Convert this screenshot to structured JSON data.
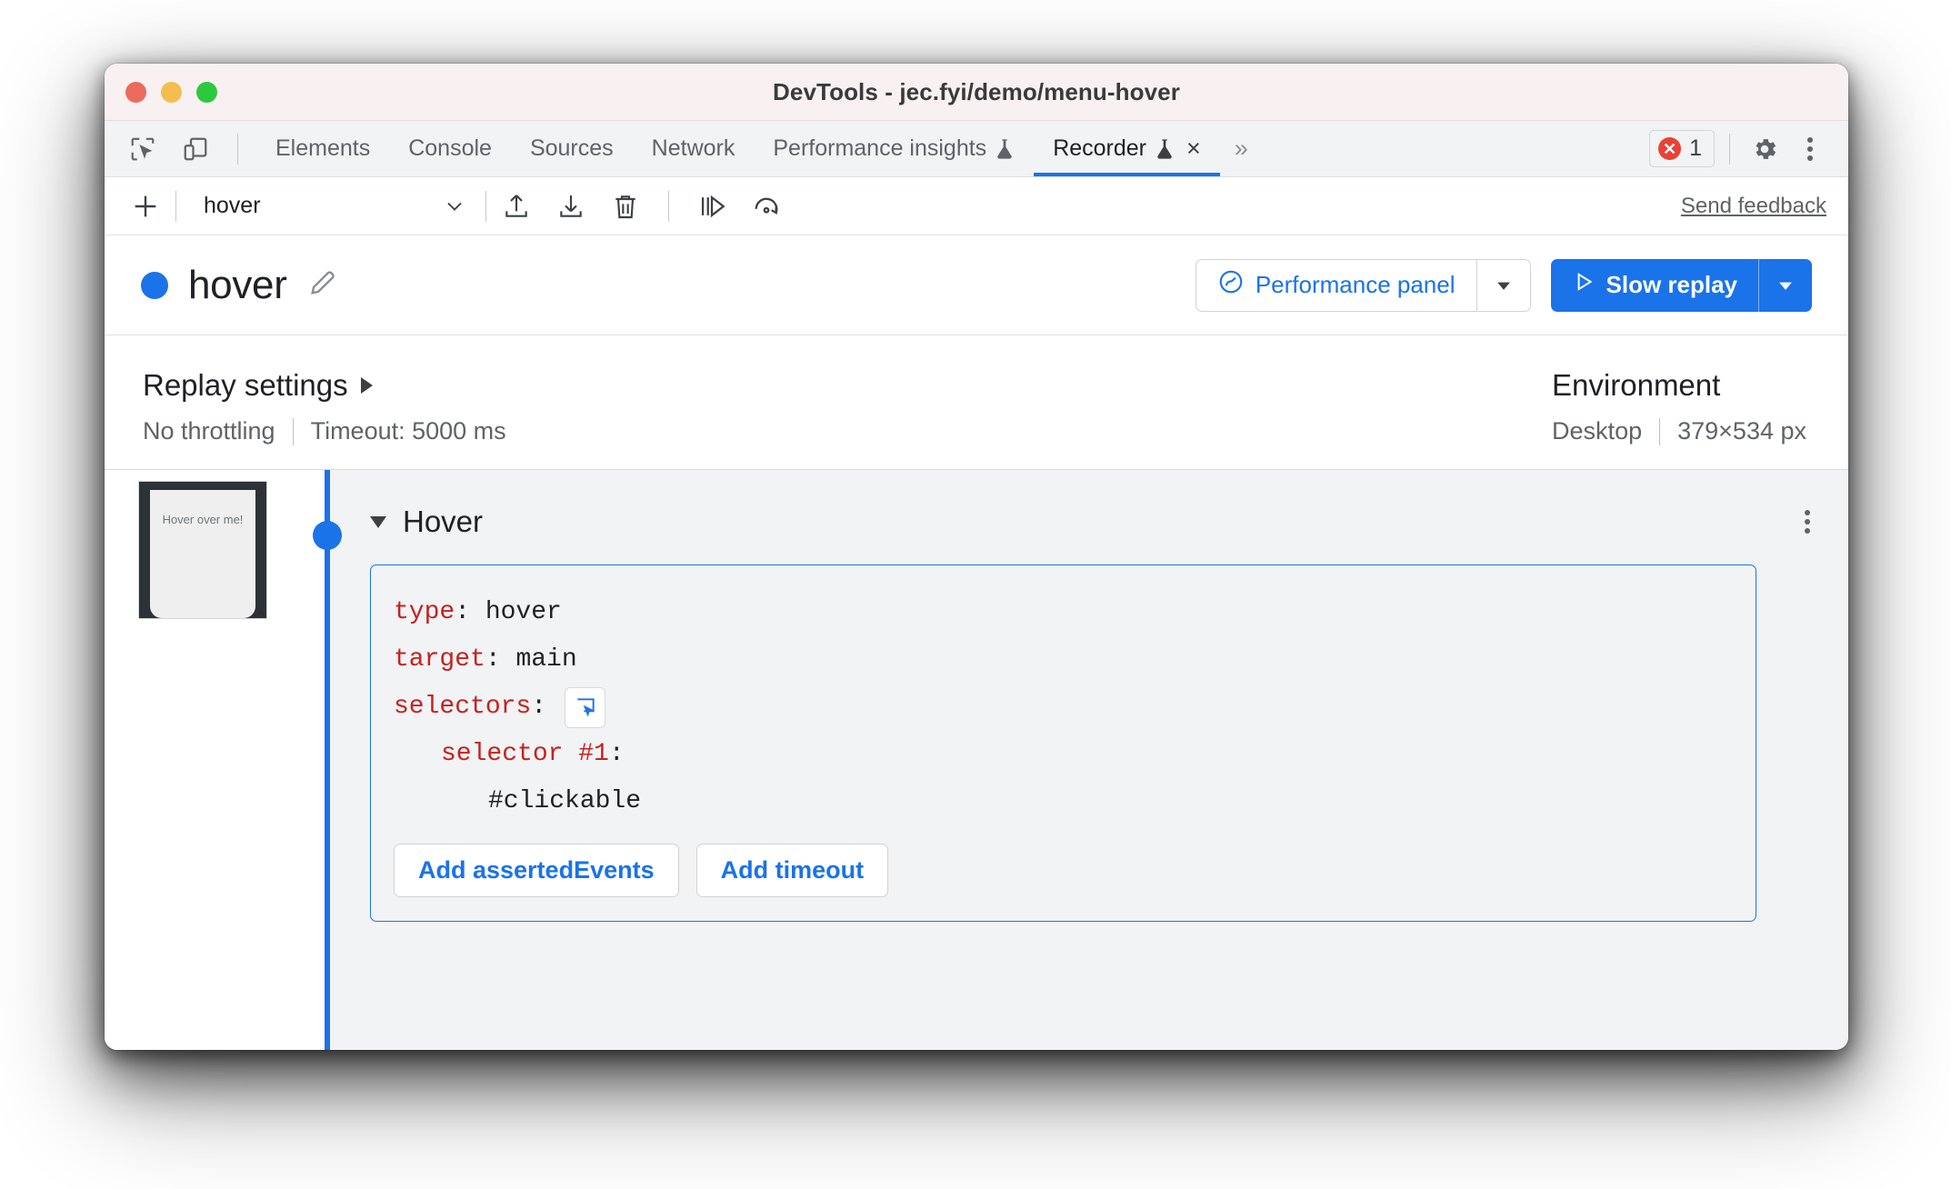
{
  "window": {
    "title": "DevTools - jec.fyi/demo/menu-hover",
    "traffic_lights": [
      "close",
      "minimize",
      "maximize"
    ]
  },
  "tabbar": {
    "left_icons": [
      "inspect-element-icon",
      "device-toolbar-icon"
    ],
    "tabs": [
      {
        "label": "Elements",
        "selected": false,
        "experimental": false,
        "closable": false
      },
      {
        "label": "Console",
        "selected": false,
        "experimental": false,
        "closable": false
      },
      {
        "label": "Sources",
        "selected": false,
        "experimental": false,
        "closable": false
      },
      {
        "label": "Network",
        "selected": false,
        "experimental": false,
        "closable": false
      },
      {
        "label": "Performance insights",
        "selected": false,
        "experimental": true,
        "closable": false
      },
      {
        "label": "Recorder",
        "selected": true,
        "experimental": true,
        "closable": true
      }
    ],
    "overflow_label": "»",
    "error_count": "1",
    "close_glyph": "×",
    "right_icons": [
      "settings-gear-icon",
      "more-options-icon"
    ]
  },
  "recorder_toolbar": {
    "add_label": "+",
    "selected_recording": "hover",
    "tool_icons": [
      "export-icon",
      "import-icon",
      "delete-icon",
      "step-over-icon",
      "replay-icon"
    ],
    "feedback_label": "Send feedback"
  },
  "recording_header": {
    "title": "hover",
    "edit_icon": "pencil-icon",
    "status_dot_color": "#1a73e8",
    "performance_button": {
      "label": "Performance panel",
      "icon": "performance-gauge-icon",
      "dropdown_glyph": "▼"
    },
    "replay_button": {
      "label": "Slow replay",
      "icon": "play-icon",
      "dropdown_glyph": "▼",
      "color": "#1a73e8"
    }
  },
  "settings": {
    "replay": {
      "title": "Replay settings",
      "expand_glyph": "▶",
      "throttling": "No throttling",
      "timeout": "Timeout: 5000 ms"
    },
    "environment": {
      "title": "Environment",
      "device": "Desktop",
      "viewport": "379×534 px"
    }
  },
  "steps": {
    "thumbnail_text": "Hover over me!",
    "step": {
      "name": "Hover",
      "collapse_glyph": "▼",
      "kebab": "more-options-icon",
      "code": [
        {
          "key": "type",
          "value": "hover",
          "indent": 0,
          "picker": false
        },
        {
          "key": "target",
          "value": "main",
          "indent": 0,
          "picker": false
        },
        {
          "key": "selectors",
          "value": "",
          "indent": 0,
          "picker": true
        },
        {
          "key": "selector #1",
          "value": "",
          "indent": 1,
          "picker": false
        },
        {
          "key": "",
          "value": "#clickable",
          "indent": 2,
          "picker": false
        }
      ],
      "buttons": [
        {
          "label": "Add assertedEvents"
        },
        {
          "label": "Add timeout"
        }
      ]
    }
  }
}
